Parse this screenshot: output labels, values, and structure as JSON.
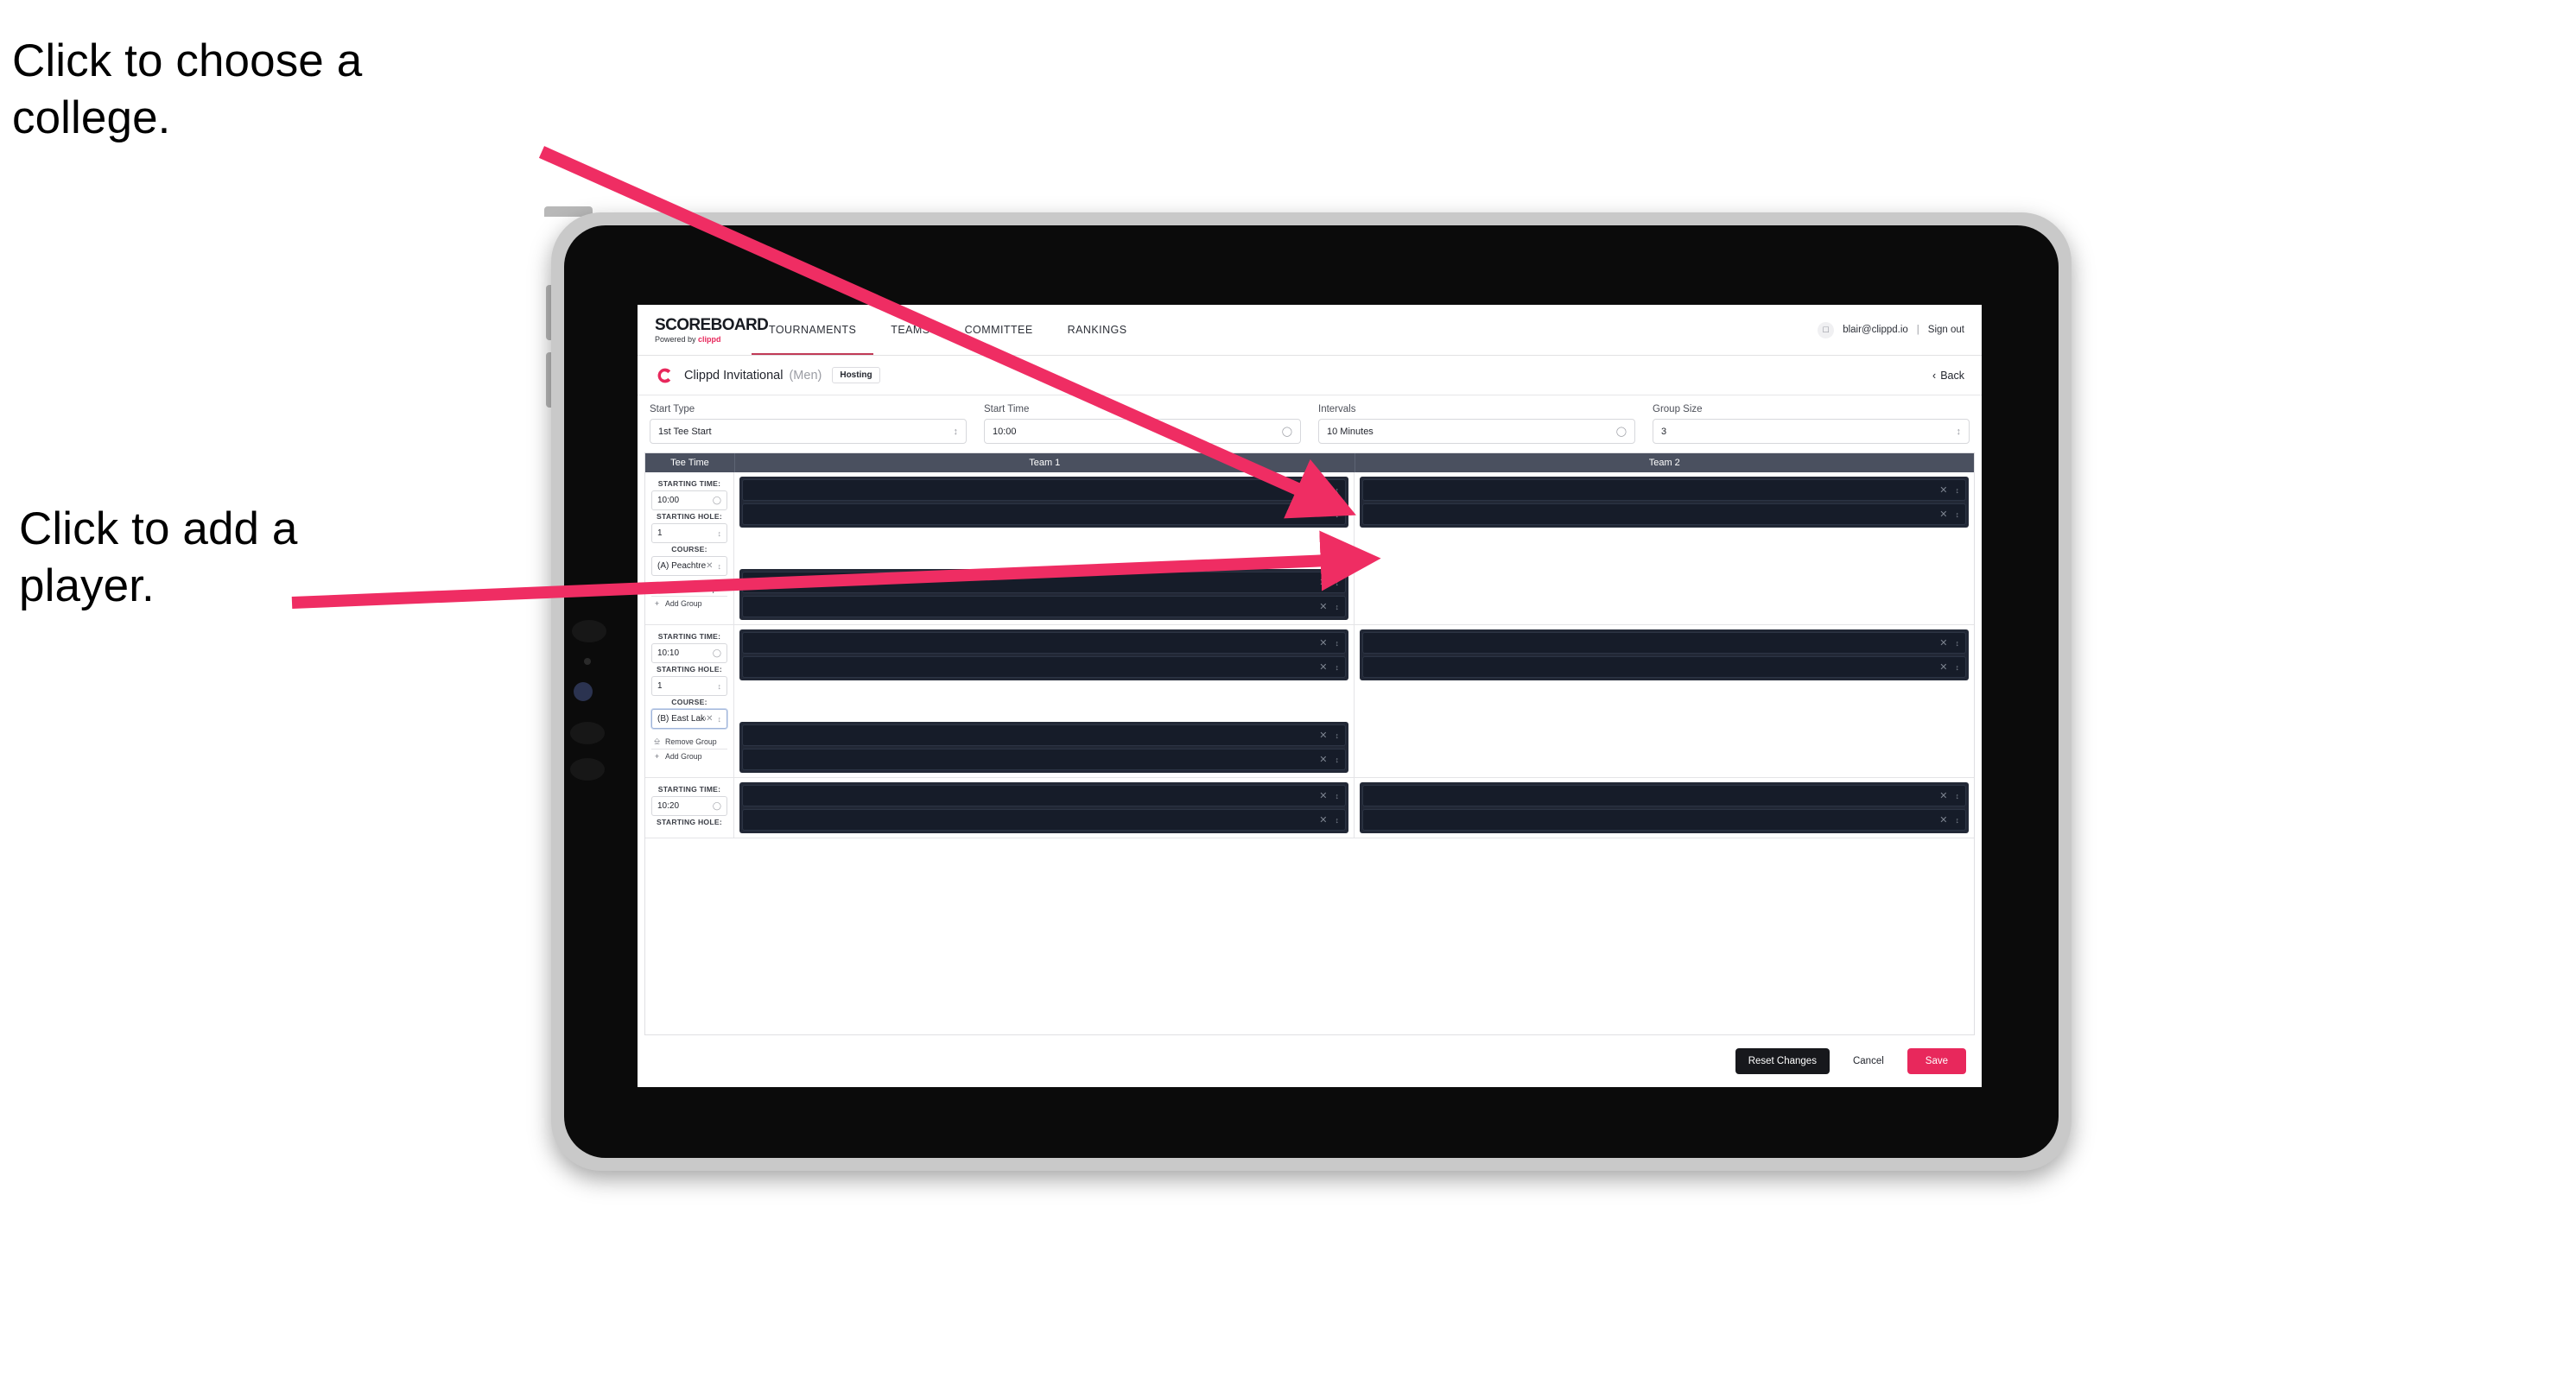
{
  "annotations": [
    {
      "id": "college",
      "text": "Click to choose a college."
    },
    {
      "id": "player",
      "text": "Click to add a player."
    }
  ],
  "colors": {
    "accent_pink": "#e8285c",
    "arrow_pink": "#ef2d63",
    "table_header": "#4a505f",
    "slot_dark": "#161c29",
    "nav_underline": "#c13a57"
  },
  "app": {
    "brand": {
      "title": "SCOREBOARD",
      "powered_prefix": "Powered by",
      "powered_brand": "clippd"
    },
    "nav": {
      "items": [
        {
          "label": "TOURNAMENTS",
          "active": true
        },
        {
          "label": "TEAMS",
          "active": false
        },
        {
          "label": "COMMITTEE",
          "active": false
        },
        {
          "label": "RANKINGS",
          "active": false
        }
      ],
      "account": {
        "avatar_icon": "user-avatar-icon",
        "email": "blair@clippd.io",
        "separator": "|",
        "signout": "Sign out"
      }
    },
    "tournament_bar": {
      "logo_icon": "clippd-c-logo-icon",
      "name": "Clippd Invitational",
      "gender": "(Men)",
      "badge": "Hosting",
      "back_icon": "chevron-left-icon",
      "back_label": "Back"
    },
    "settings": [
      {
        "label": "Start Type",
        "value": "1st Tee Start",
        "icon": "stepper-icon"
      },
      {
        "label": "Start Time",
        "value": "10:00",
        "icon": "clock-icon"
      },
      {
        "label": "Intervals",
        "value": "10 Minutes",
        "icon": "clock-icon"
      },
      {
        "label": "Group Size",
        "value": "3",
        "icon": "stepper-icon"
      }
    ],
    "table": {
      "columns": [
        "Tee Time",
        "Team 1",
        "Team 2"
      ],
      "labels": {
        "starting_time": "STARTING TIME:",
        "starting_hole": "STARTING HOLE:",
        "course": "COURSE:"
      },
      "actions": {
        "remove_group": "Remove Group",
        "add_group": "Add Group",
        "remove_icon": "trash-icon",
        "add_icon": "plus-icon"
      },
      "slot_icons": {
        "clear": "close-x-icon",
        "stepper": "up-down-chevron-icon"
      },
      "rows": [
        {
          "starting_time": "10:00",
          "starting_hole": "1",
          "course": "(A) Peachtree GC",
          "course_focused": false,
          "team1_slots": 2,
          "team1_extra_slots": 2,
          "team2_slots": 2,
          "team2_extra_slots": 0
        },
        {
          "starting_time": "10:10",
          "starting_hole": "1",
          "course": "(B) East Lake GC",
          "course_focused": true,
          "team1_slots": 2,
          "team1_extra_slots": 2,
          "team2_slots": 2,
          "team2_extra_slots": 0
        },
        {
          "starting_time": "10:20",
          "starting_hole": "",
          "course": "",
          "course_focused": false,
          "team1_slots": 2,
          "team1_extra_slots": 0,
          "team2_slots": 2,
          "team2_extra_slots": 0
        }
      ]
    },
    "footer": {
      "reset": "Reset Changes",
      "cancel": "Cancel",
      "save": "Save"
    }
  }
}
